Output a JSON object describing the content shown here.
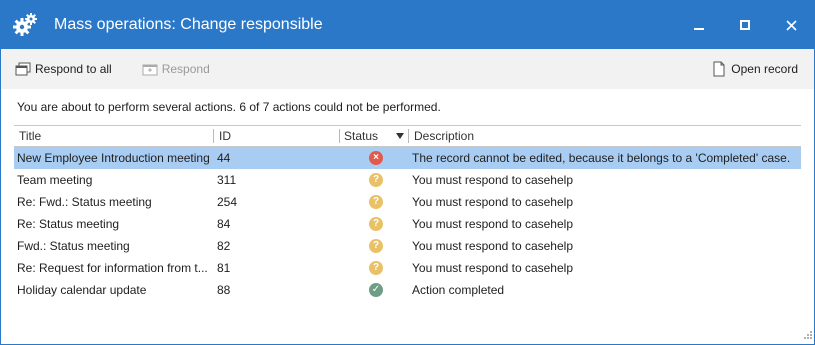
{
  "window": {
    "title": "Mass operations: Change responsible"
  },
  "toolbar": {
    "respond_all": "Respond to all",
    "respond": "Respond",
    "open_record": "Open record"
  },
  "message": "You are about to perform several actions. 6 of 7 actions could not be performed.",
  "columns": {
    "title": "Title",
    "id": "ID",
    "status": "Status",
    "description": "Description"
  },
  "rows": [
    {
      "title": "New Employee Introduction meeting",
      "id": "44",
      "status": "error",
      "description": "The record cannot be edited, because it belongs to a 'Completed' case.",
      "selected": true
    },
    {
      "title": "Team meeting",
      "id": "311",
      "status": "warning",
      "description": "You must respond to casehelp"
    },
    {
      "title": "Re: Fwd.: Status meeting",
      "id": "254",
      "status": "warning",
      "description": "You must respond to casehelp"
    },
    {
      "title": "Re: Status meeting",
      "id": "84",
      "status": "warning",
      "description": "You must respond to casehelp"
    },
    {
      "title": "Fwd.: Status meeting",
      "id": "82",
      "status": "warning",
      "description": "You must respond to casehelp"
    },
    {
      "title": "Re: Request for information from t...",
      "id": "81",
      "status": "warning",
      "description": "You must respond to casehelp"
    },
    {
      "title": "Holiday calendar update",
      "id": "88",
      "status": "ok",
      "description": "Action completed"
    }
  ],
  "status_glyphs": {
    "error": "×",
    "warning": "?",
    "ok": "✓"
  },
  "colors": {
    "titlebar": "#2b78c9",
    "selected_row": "#a9cdf2",
    "error": "#e05b4b",
    "warning": "#e9c267",
    "ok": "#6e9f86"
  }
}
